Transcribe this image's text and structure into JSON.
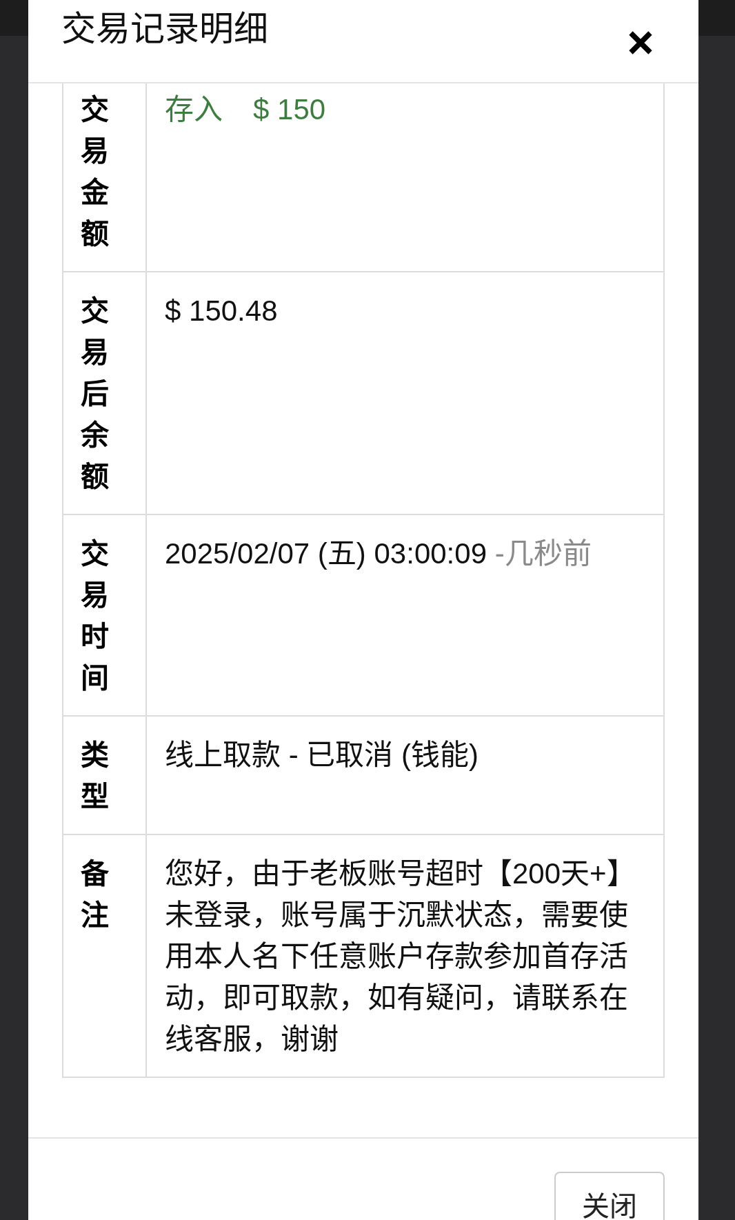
{
  "dialog": {
    "title": "交易记录明细"
  },
  "details": [
    {
      "kind": "amount",
      "label": "交易金额",
      "direction": "存入",
      "amount": "$ 150"
    },
    {
      "kind": "text",
      "label": "交易后余额",
      "value": "$ 150.48"
    },
    {
      "kind": "time",
      "label": "交易时间",
      "value": "2025/02/07 (五) 03:00:09",
      "relative": "-几秒前"
    },
    {
      "kind": "text",
      "label": "类型",
      "value": "线上取款 - 已取消 (钱能)"
    },
    {
      "kind": "text",
      "label": "备注",
      "value": "您好，由于老板账号超时【200天+】未登录，账号属于沉默状态，需要使用本人名下任意账户存款参加首存活动，即可取款，如有疑问，请联系在线客服，谢谢"
    }
  ],
  "footer": {
    "button": "关闭"
  }
}
